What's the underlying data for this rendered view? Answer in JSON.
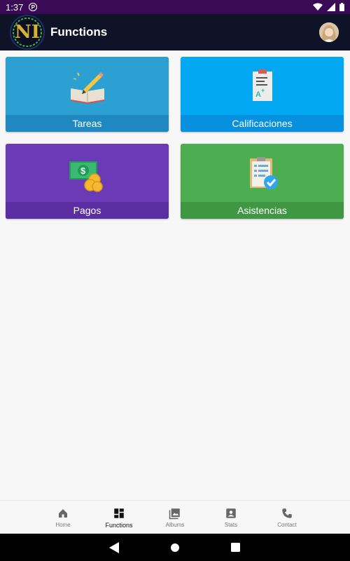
{
  "status_bar": {
    "time": "1:37",
    "app_badge": "P"
  },
  "app_bar": {
    "title": "Functions",
    "logo_text": "NI",
    "logo_ring_text": "NEW LEARNING ATELIER"
  },
  "cards": [
    {
      "label": "Tareas",
      "icon": "book-pencil-icon",
      "color": "#2c9fd3"
    },
    {
      "label": "Calificaciones",
      "icon": "graded-paper-icon",
      "color": "#03a8f3"
    },
    {
      "label": "Pagos",
      "icon": "money-coins-icon",
      "color": "#6b3ab7"
    },
    {
      "label": "Asistencias",
      "icon": "checklist-icon",
      "color": "#4cae50"
    }
  ],
  "bottom_nav": {
    "items": [
      {
        "label": "Home",
        "icon": "home-icon"
      },
      {
        "label": "Functions",
        "icon": "dashboard-icon",
        "active": true
      },
      {
        "label": "Albums",
        "icon": "photo-album-icon"
      },
      {
        "label": "Stats",
        "icon": "person-card-icon"
      },
      {
        "label": "Contact",
        "icon": "phone-icon"
      }
    ]
  },
  "colors": {
    "status_bar": "#3b0a57",
    "app_bar": "#0e1327",
    "background": "#f7f7f7"
  }
}
